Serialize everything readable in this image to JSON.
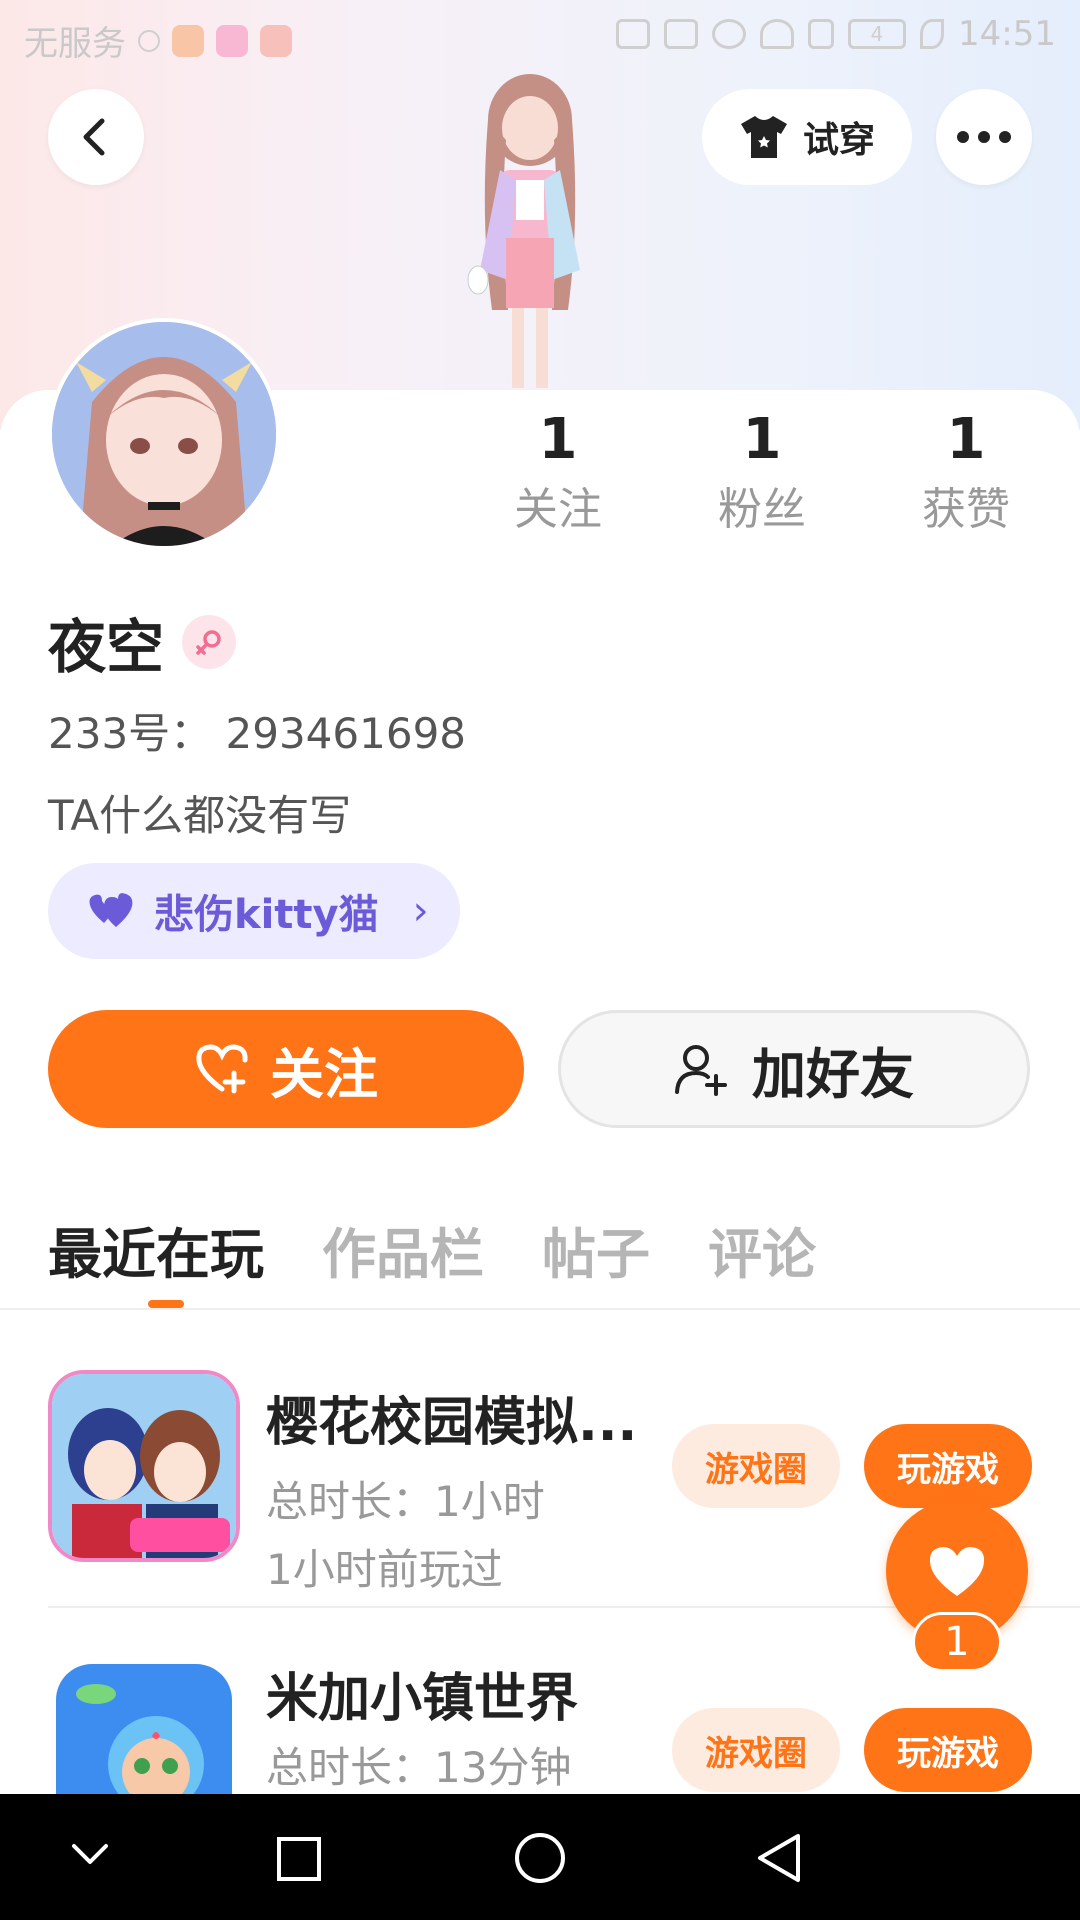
{
  "status_bar": {
    "carrier": "无服务",
    "time": "14:51",
    "battery": "4"
  },
  "header": {
    "tryon_label": "试穿"
  },
  "profile": {
    "stats": [
      {
        "value": "1",
        "label": "关注"
      },
      {
        "value": "1",
        "label": "粉丝"
      },
      {
        "value": "1",
        "label": "获赞"
      }
    ],
    "name": "夜空",
    "id_line": "233号： 293461698",
    "bio": "TA什么都没有写",
    "fan_tag": "悲伤kitty猫",
    "follow_label": "关注",
    "add_friend_label": "加好友"
  },
  "tabs": [
    "最近在玩",
    "作品栏",
    "帖子",
    "评论"
  ],
  "games": [
    {
      "title": "樱花校园模拟...",
      "total": "总时长：1小时",
      "last_played": "1小时前玩过",
      "circle_label": "游戏圈",
      "play_label": "玩游戏"
    },
    {
      "title": "米加小镇世界",
      "total": "总时长：13分钟",
      "circle_label": "游戏圈",
      "play_label": "玩游戏"
    }
  ],
  "like_float": {
    "count": "1"
  },
  "colors": {
    "accent": "#ff7417",
    "fan_tag_bg": "#ecebff",
    "fan_tag_text": "#6b5bd8"
  }
}
